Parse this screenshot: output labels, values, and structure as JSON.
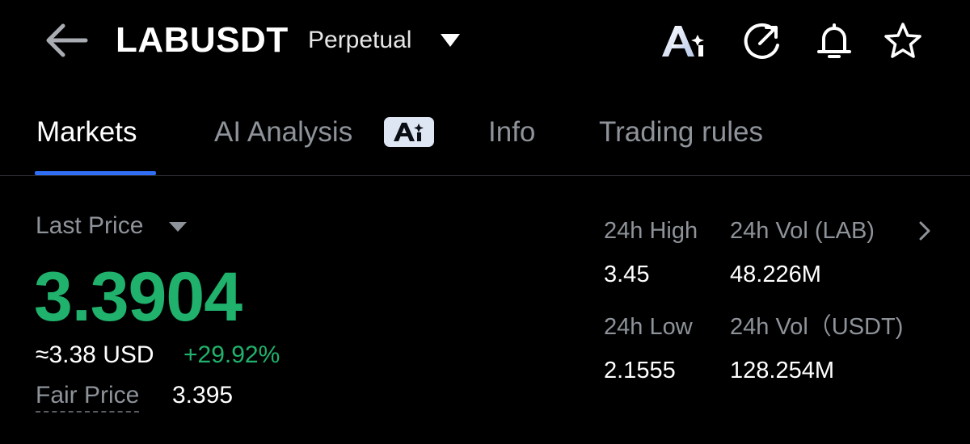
{
  "header": {
    "title": "LABUSDT",
    "subtitle": "Perpetual",
    "icons": [
      "back-arrow-icon",
      "ai-icon",
      "share-icon",
      "bell-icon",
      "star-icon"
    ]
  },
  "tabs": [
    {
      "label": "Markets",
      "active": true
    },
    {
      "label": "AI Analysis",
      "badge_icon": "ai-badge-icon"
    },
    {
      "label": "Info"
    },
    {
      "label": "Trading rules"
    }
  ],
  "price": {
    "label": "Last Price",
    "value": "3.3904",
    "usd_approx": "≈3.38 USD",
    "change_pct": "+29.92%",
    "fair_label": "Fair Price",
    "fair_value": "3.395"
  },
  "stats": {
    "high_label": "24h High",
    "high_value": "3.45",
    "low_label": "24h Low",
    "low_value": "2.1555",
    "vol_base_label": "24h Vol (LAB)",
    "vol_base_value": "48.226M",
    "vol_quote_label": "24h Vol（USDT)",
    "vol_quote_value": "128.254M"
  },
  "colors": {
    "background": "#000000",
    "up_green": "#20b26c",
    "accent_blue": "#2f6ef5",
    "muted_text": "#8e939a",
    "badge_bg": "#dfe6f3"
  }
}
